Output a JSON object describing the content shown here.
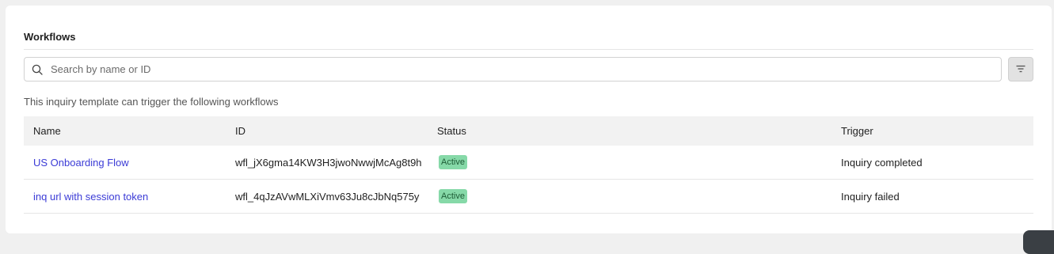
{
  "section": {
    "title": "Workflows",
    "description": "This inquiry template can trigger the following workflows"
  },
  "search": {
    "placeholder": "Search by name or ID",
    "icon": "search-icon"
  },
  "filter": {
    "icon": "filter-icon"
  },
  "table": {
    "headers": {
      "name": "Name",
      "id": "ID",
      "status": "Status",
      "trigger": "Trigger"
    },
    "rows": [
      {
        "name": "US Onboarding Flow",
        "id": "wfl_jX6gma14KW3H3jwoNwwjMcAg8t9h",
        "status": "Active",
        "trigger": "Inquiry completed"
      },
      {
        "name": "inq url with session token",
        "id": "wfl_4qJzAVwMLXiVmv63Ju8cJbNq575y",
        "status": "Active",
        "trigger": "Inquiry failed"
      }
    ]
  },
  "colors": {
    "link": "#3b3bd6",
    "badge_bg": "#86d9a8",
    "badge_text": "#1e5c36"
  }
}
